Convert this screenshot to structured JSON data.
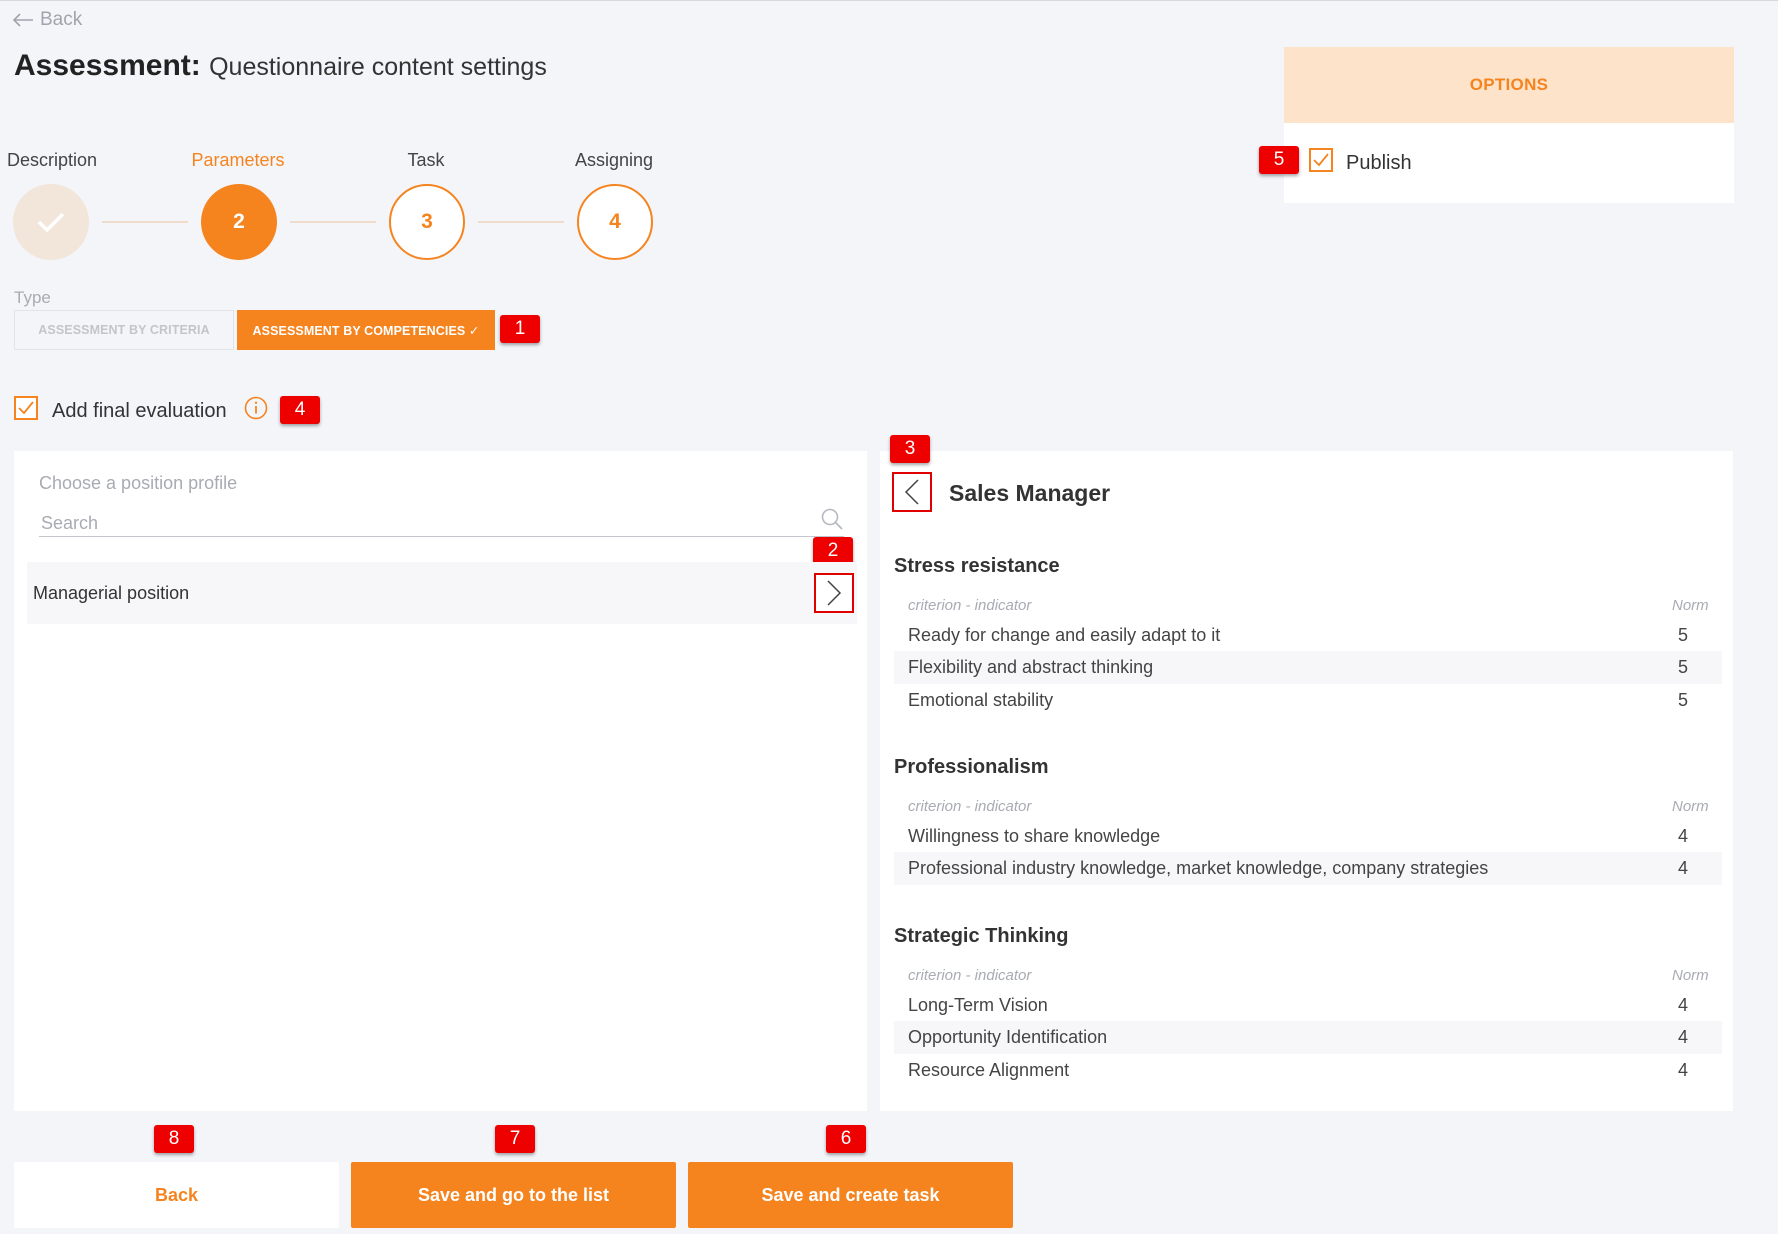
{
  "nav": {
    "back_label": "Back"
  },
  "header": {
    "title_bold": "Assessment:",
    "title_rest": "Questionnaire content settings"
  },
  "stepper": {
    "steps": [
      {
        "label": "Description",
        "number": "",
        "state": "done"
      },
      {
        "label": "Parameters",
        "number": "2",
        "state": "current"
      },
      {
        "label": "Task",
        "number": "3",
        "state": "todo"
      },
      {
        "label": "Assigning",
        "number": "4",
        "state": "todo"
      }
    ]
  },
  "type_selector": {
    "label": "Type",
    "options": [
      "ASSESSMENT BY CRITERIA",
      "ASSESSMENT BY COMPETENCIES ✓"
    ],
    "selected": "ASSESSMENT BY COMPETENCIES"
  },
  "final_evaluation": {
    "label": "Add final evaluation",
    "checked": true
  },
  "position_picker": {
    "label": "Choose a position profile",
    "search_placeholder": "Search",
    "items": [
      {
        "label": "Managerial position"
      }
    ]
  },
  "profile": {
    "title": "Sales Manager",
    "column_criterion": "criterion - indicator",
    "column_norm": "Norm",
    "sections": [
      {
        "title": "Stress resistance",
        "rows": [
          {
            "name": "Ready for change and easily adapt to it",
            "norm": "5"
          },
          {
            "name": "Flexibility and abstract thinking",
            "norm": "5"
          },
          {
            "name": "Emotional stability",
            "norm": "5"
          }
        ]
      },
      {
        "title": "Professionalism",
        "rows": [
          {
            "name": "Willingness to share knowledge",
            "norm": "4"
          },
          {
            "name": "Professional industry knowledge, market knowledge, company strategies",
            "norm": "4"
          }
        ]
      },
      {
        "title": "Strategic Thinking",
        "rows": [
          {
            "name": "Long-Term Vision",
            "norm": "4"
          },
          {
            "name": "Opportunity Identification",
            "norm": "4"
          },
          {
            "name": "Resource Alignment",
            "norm": "4"
          }
        ]
      }
    ]
  },
  "options": {
    "title": "OPTIONS",
    "publish_label": "Publish",
    "publish_checked": true
  },
  "footer": {
    "back_label": "Back",
    "save_list_label": "Save and go to the list",
    "save_task_label": "Save and create task"
  },
  "annotations": [
    "1",
    "2",
    "3",
    "4",
    "5",
    "6",
    "7",
    "8"
  ],
  "colors": {
    "accent": "#f5841f",
    "badge": "#ee0000",
    "options_bg": "#fde3c9",
    "page_bg": "#f4f5f9"
  },
  "icons": [
    "arrow-left-icon",
    "check-icon",
    "info-icon",
    "search-icon",
    "chevron-right-icon",
    "chevron-left-icon"
  ]
}
